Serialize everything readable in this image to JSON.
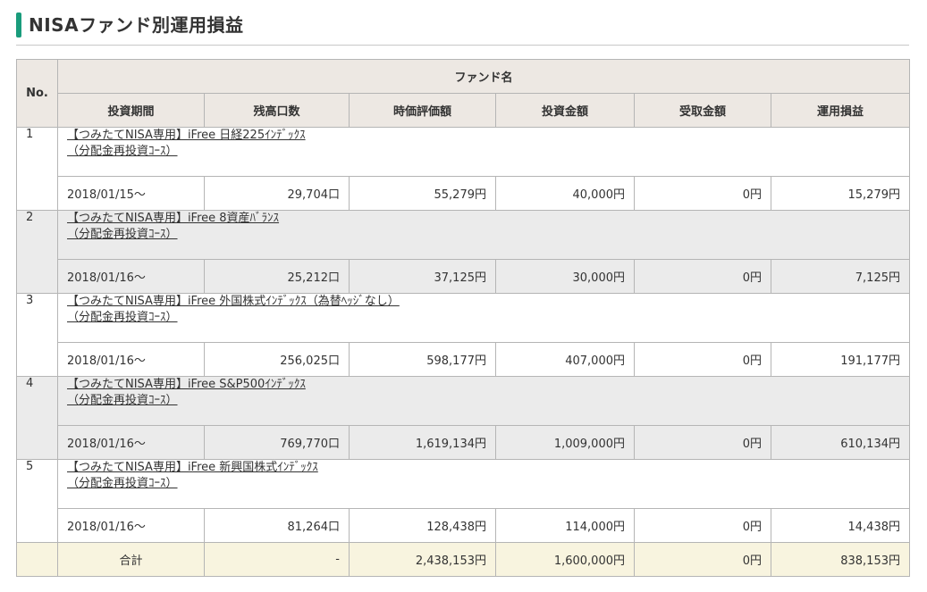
{
  "page": {
    "title": "NISAファンド別運用損益"
  },
  "table": {
    "headers": {
      "no": "No.",
      "fund_name": "ファンド名",
      "period": "投資期間",
      "units": "残高口数",
      "market_value": "時価評価額",
      "invested": "投資金額",
      "received": "受取金額",
      "profit": "運用損益"
    },
    "rows": [
      {
        "no": "1",
        "fund_line1": "【つみたてNISA専用】iFree 日経225ｲﾝﾃﾞｯｸｽ",
        "fund_line2": "（分配金再投資ｺｰｽ）",
        "period": "2018/01/15～",
        "units": "29,704口",
        "market_value": "55,279円",
        "invested": "40,000円",
        "received": "0円",
        "profit": "15,279円"
      },
      {
        "no": "2",
        "fund_line1": "【つみたてNISA専用】iFree 8資産ﾊﾞﾗﾝｽ",
        "fund_line2": "（分配金再投資ｺｰｽ）",
        "period": "2018/01/16～",
        "units": "25,212口",
        "market_value": "37,125円",
        "invested": "30,000円",
        "received": "0円",
        "profit": "7,125円"
      },
      {
        "no": "3",
        "fund_line1": "【つみたてNISA専用】iFree 外国株式ｲﾝﾃﾞｯｸｽ（為替ﾍｯｼﾞなし）",
        "fund_line2": "（分配金再投資ｺｰｽ）",
        "period": "2018/01/16～",
        "units": "256,025口",
        "market_value": "598,177円",
        "invested": "407,000円",
        "received": "0円",
        "profit": "191,177円"
      },
      {
        "no": "4",
        "fund_line1": "【つみたてNISA専用】iFree S&P500ｲﾝﾃﾞｯｸｽ",
        "fund_line2": "（分配金再投資ｺｰｽ）",
        "period": "2018/01/16～",
        "units": "769,770口",
        "market_value": "1,619,134円",
        "invested": "1,009,000円",
        "received": "0円",
        "profit": "610,134円"
      },
      {
        "no": "5",
        "fund_line1": "【つみたてNISA専用】iFree 新興国株式ｲﾝﾃﾞｯｸｽ",
        "fund_line2": "（分配金再投資ｺｰｽ）",
        "period": "2018/01/16～",
        "units": "81,264口",
        "market_value": "128,438円",
        "invested": "114,000円",
        "received": "0円",
        "profit": "14,438円"
      }
    ],
    "total": {
      "label": "合計",
      "units": "-",
      "market_value": "2,438,153円",
      "invested": "1,600,000円",
      "received": "0円",
      "profit": "838,153円"
    }
  },
  "colors": {
    "accent": "#1a9c7c",
    "header_bg": "#ede8e3",
    "even_row_bg": "#ebebeb",
    "total_row_bg": "#f8f4df",
    "border": "#b5b5b5"
  }
}
